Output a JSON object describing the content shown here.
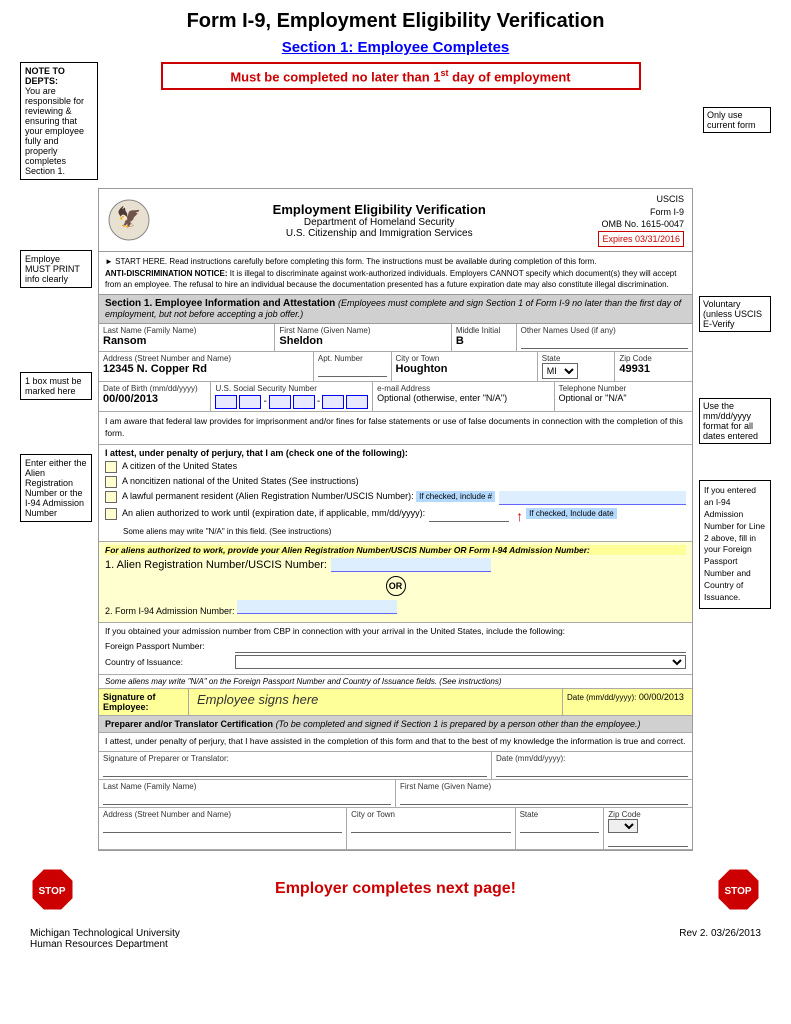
{
  "page": {
    "title": "Form I-9, Employment Eligibility Verification",
    "section_header": "Section 1: Employee Completes",
    "must_complete": "Must be completed no later than 1",
    "must_complete_super": "st",
    "must_complete_end": " day of employment"
  },
  "left_annotations": {
    "note_to_depts": {
      "title": "NOTE TO DEPTS:",
      "text": "You are responsible for reviewing & ensuring that your employee fully and properly completes Section 1."
    },
    "employee_print": {
      "text": "Employe MUST PRINT info clearly"
    },
    "one_box": {
      "text": "1 box must be marked here"
    },
    "alien_number": {
      "text": "Enter either the Alien Registration Number or the I-94 Admission Number"
    }
  },
  "right_annotations": {
    "only_use": {
      "text": "Only use current form"
    },
    "voluntary": {
      "text": "Voluntary (unless USCIS E-Verify"
    },
    "mm_dd_yyyy": {
      "text": "Use the mm/dd/yyyy format for all dates entered"
    }
  },
  "form_header": {
    "title": "Employment Eligibility Verification",
    "dept": "Department of Homeland Security",
    "agency": "U.S. Citizenship and Immigration Services",
    "uscis_label": "USCIS",
    "form_number": "Form I-9",
    "omb": "OMB No. 1615-0047",
    "expires": "Expires 03/31/2016"
  },
  "notice": {
    "start": "► START HERE.  Read instructions carefully before completing this form. The instructions must be available during completion of this form.",
    "anti_disc": "ANTI-DISCRIMINATION NOTICE:",
    "anti_disc_text": " It is illegal to discriminate against work-authorized individuals. Employers CANNOT specify which document(s) they will accept from an employee. The refusal to hire an individual because the documentation presented has a future expiration date may also constitute illegal discrimination."
  },
  "section1": {
    "title": "Section 1. Employee Information and Attestation",
    "italic_note": "(Employees must complete and sign Section 1 of Form I-9 no later than the first day of employment, but not before accepting a job offer.)",
    "fields": {
      "last_name_label": "Last Name (Family Name)",
      "last_name_value": "Ransom",
      "first_name_label": "First Name (Given Name)",
      "first_name_value": "Sheldon",
      "middle_initial_label": "Middle Initial",
      "middle_initial_value": "B",
      "other_names_label": "Other Names Used (if any)",
      "address_label": "Address (Street Number and Name)",
      "address_value": "12345 N. Copper Rd",
      "apt_label": "Apt. Number",
      "city_label": "City or Town",
      "city_value": "Houghton",
      "state_label": "State",
      "state_value": "MI",
      "zip_label": "Zip Code",
      "zip_value": "49931",
      "dob_label": "Date of Birth (mm/dd/yyyy)",
      "dob_value": "00/00/2013",
      "ssn_label": "U.S. Social Security Number",
      "email_label": "e-mail Address",
      "email_optional": "Optional (otherwise, enter \"N/A\")",
      "phone_label": "Telephone Number",
      "phone_optional": "Optional or \"N/A\""
    },
    "federal_law": "I am aware that federal law provides for imprisonment and/or fines for false statements or use of false documents in connection with the completion of this form.",
    "attest_title": "I attest, under penalty of perjury, that I am (check one of the following):",
    "citizen": "A citizen of the United States",
    "noncitizen_national": "A noncitizen national of the United States (See instructions)",
    "perm_resident": "A lawful permanent resident (Alien Registration Number/USCIS Number):",
    "if_checked_number": "If checked, include #",
    "authorized": "An alien authorized to work until (expiration date, if applicable, mm/dd/yyyy):",
    "if_checked_date": "If checked, Include date",
    "na_field": "Some aliens may write \"N/A\" in this field.",
    "see_instructions": "(See instructions)",
    "alien_auth_note": "For aliens authorized to work, provide your Alien Registration Number/USCIS Number OR Form I-94 Admission Number:",
    "alien_reg_label": "1. Alien Registration Number/USCIS Number:",
    "or_text": "OR",
    "i94_label": "2. Form I-94 Admission Number:",
    "i94_note": "If you obtained your admission number from CBP in connection with your arrival in the United States, include the following:",
    "foreign_passport_label": "Foreign Passport Number:",
    "country_label": "Country of Issuance:",
    "na_note": "Some aliens may write \"N/A\" on the Foreign Passport Number and Country of Issuance fields. (See instructions)",
    "sig_label": "Signature of Employee:",
    "sig_placeholder": "Employee signs here",
    "date_label": "Date (mm/dd/yyyy):",
    "date_value": "00/00/2013"
  },
  "preparer": {
    "title": "Preparer and/or Translator Certification",
    "italic_note": "(To be completed and signed if Section 1 is prepared by a person other than the employee.)",
    "attest": "I attest, under penalty of perjury, that I have assisted in the completion of this form and that to the best of my knowledge the information is true and correct.",
    "sig_label": "Signature of Preparer or Translator:",
    "date_label": "Date (mm/dd/yyyy):",
    "last_name_label": "Last Name (Family Name)",
    "first_name_label": "First Name (Given Name)",
    "address_label": "Address (Street Number and Name)",
    "city_label": "City or Town",
    "state_label": "State",
    "zip_label": "Zip Code"
  },
  "bottom": {
    "employer_next": "Employer completes next page!"
  },
  "footer": {
    "left_line1": "Michigan Technological University",
    "left_line2": "Human Resources Department",
    "right": "Rev 2. 03/26/2013"
  },
  "callout_i94": {
    "text": "If you entered an I-94 Admission Number for Line 2 above, fill in your Foreign Passport Number and Country of Issuance."
  }
}
